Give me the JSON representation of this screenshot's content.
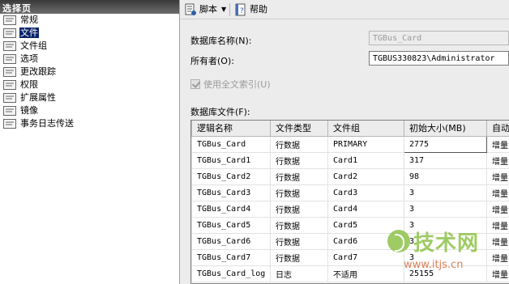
{
  "left_pane": {
    "header": "选择页",
    "items": [
      {
        "label": "常规",
        "selected": false
      },
      {
        "label": "文件",
        "selected": true
      },
      {
        "label": "文件组",
        "selected": false
      },
      {
        "label": "选项",
        "selected": false
      },
      {
        "label": "更改跟踪",
        "selected": false
      },
      {
        "label": "权限",
        "selected": false
      },
      {
        "label": "扩展属性",
        "selected": false
      },
      {
        "label": "镜像",
        "selected": false
      },
      {
        "label": "事务日志传送",
        "selected": false
      }
    ]
  },
  "toolbar": {
    "script_label": "脚本",
    "help_label": "帮助"
  },
  "form": {
    "db_name_label": "数据库名称(N):",
    "db_name_value": "TGBus_Card",
    "owner_label": "所有者(O):",
    "owner_value": "TGBUS330823\\Administrator",
    "fulltext_label": "使用全文索引(U)",
    "db_files_label": "数据库文件(F):"
  },
  "grid": {
    "columns": [
      "逻辑名称",
      "文件类型",
      "文件组",
      "初始大小(MB)",
      "自动"
    ],
    "rows": [
      [
        "TGBus_Card",
        "行数据",
        "PRIMARY",
        "2775",
        "增量"
      ],
      [
        "TGBus_Card1",
        "行数据",
        "Card1",
        "317",
        "增量"
      ],
      [
        "TGBus_Card2",
        "行数据",
        "Card2",
        "98",
        "增量"
      ],
      [
        "TGBus_Card3",
        "行数据",
        "Card3",
        "3",
        "增量"
      ],
      [
        "TGBus_Card4",
        "行数据",
        "Card4",
        "3",
        "增量"
      ],
      [
        "TGBus_Card5",
        "行数据",
        "Card5",
        "3",
        "增量"
      ],
      [
        "TGBus_Card6",
        "行数据",
        "Card6",
        "3",
        "增量"
      ],
      [
        "TGBus_Card7",
        "行数据",
        "Card7",
        "3",
        "增量"
      ],
      [
        "TGBus_Card_log",
        "日志",
        "不适用",
        "25155",
        "增量"
      ]
    ]
  },
  "watermark": {
    "text": "技术网",
    "url": "www.itjs.cn"
  },
  "colors": {
    "selection": "#0a246a",
    "watermark_green": "#8fc24b",
    "watermark_orange": "#d66a3a"
  }
}
